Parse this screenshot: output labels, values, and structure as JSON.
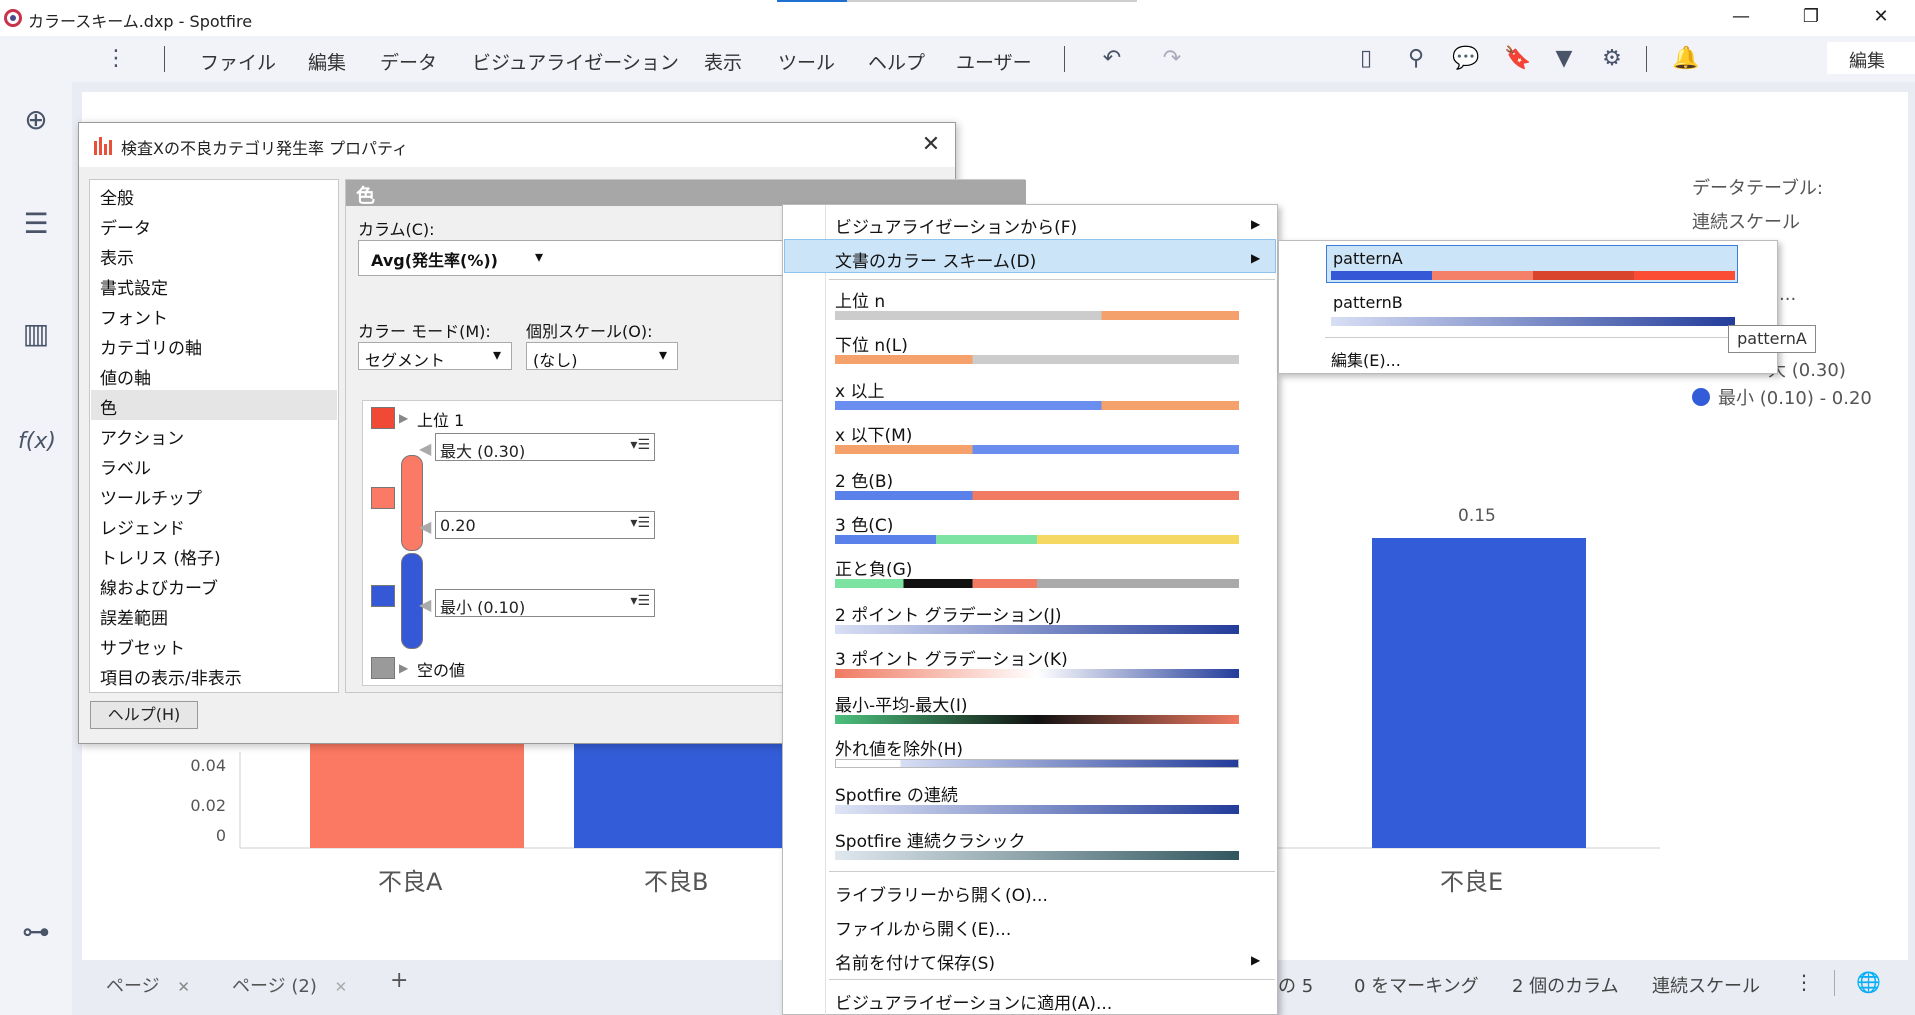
{
  "window": {
    "title": "カラースキーム.dxp - Spotfire",
    "minimize": "—",
    "maximize": "❐",
    "close": "✕"
  },
  "menubar": {
    "overflow": "⋮",
    "items": [
      "ファイル",
      "編集",
      "データ",
      "ビジュアライゼーション",
      "表示",
      "ツール",
      "ヘルプ",
      "ユーザー"
    ],
    "mode_select": "編集",
    "mode_chevron": "⌄"
  },
  "chart": {
    "categories": [
      "不良A",
      "不良B",
      "不良E"
    ],
    "bar_E_value_label": "0.15",
    "y_ticks": [
      "0.04",
      "0.02",
      "0"
    ],
    "legend": {
      "line1": "データテーブル:",
      "line2": "連続スケール",
      "partial1": "(...",
      "max_label": "大 (0.30)",
      "min_label": "最小 (0.10) - 0.20"
    },
    "colors": {
      "bar_A": "#fb7862",
      "bar_B": "#335dd8",
      "bar_red": "#fb4d34",
      "bar_E": "#335dd8"
    }
  },
  "bottom_bar": {
    "tabs": [
      {
        "label": "ページ",
        "close": "✕"
      },
      {
        "label": "ページ (2)",
        "close": "✕"
      }
    ],
    "add_tab": "+",
    "status": [
      "の 5",
      "0 をマーキング",
      "2 個のカラム",
      "連続スケール"
    ],
    "overflow": "⋮"
  },
  "dialog": {
    "title": "検査Xの不良カテゴリ発生率 プロパティ",
    "close": "✕",
    "nav_items": [
      "全般",
      "データ",
      "表示",
      "書式設定",
      "フォント",
      "カテゴリの軸",
      "値の軸",
      "色",
      "アクション",
      "ラベル",
      "ツールチップ",
      "レジェンド",
      "トレリス (格子)",
      "線およびカーブ",
      "誤差範囲",
      "サブセット",
      "項目の表示/非表示"
    ],
    "selected_nav_index": 7,
    "help_button": "ヘルプ(H)",
    "panel_title": "色",
    "column_label": "カラム(C):",
    "column_value": "Avg(発生率(%))",
    "color_mode_label": "カラー モード(M):",
    "color_mode_value": "セグメント",
    "individual_scale_label": "個別スケール(O):",
    "individual_scale_value": "(なし)",
    "top_rule": "上位 1",
    "max_value": "最大 (0.30)",
    "mid_value": "0.20",
    "min_value": "最小 (0.10)",
    "empty_value": "空の値",
    "dd_arrow": "▾",
    "menu_glyph": "▾☰",
    "colors": {
      "top": "#f04a36",
      "upper": "#fa7a66",
      "lower": "#3558d6",
      "empty": "#9a9a9a"
    }
  },
  "context_menu": {
    "items": {
      "from_vis": "ビジュアライゼーションから(F)",
      "doc_schemes": "文書のカラー スキーム(D)",
      "top_n": "上位 n",
      "bottom_n": "下位 n(L)",
      "x_above": "x 以上",
      "x_below": "x 以下(M)",
      "two_color": "2 色(B)",
      "three_color": "3 色(C)",
      "pos_neg": "正と負(G)",
      "two_point": "2 ポイント グラデーション(J)",
      "three_point": "3 ポイント グラデーション(K)",
      "min_avg_max": "最小-平均-最大(I)",
      "exclude_outliers": "外れ値を除外(H)",
      "spotfire_cont": "Spotfire の連続",
      "spotfire_classic": "Spotfire 連続クラシック",
      "open_library": "ライブラリーから開く(O)...",
      "open_file": "ファイルから開く(E)...",
      "save_as": "名前を付けて保存(S)",
      "apply_vis": "ビジュアライゼーションに適用(A)..."
    },
    "arrow": "▶"
  },
  "submenu": {
    "patternA": "patternA",
    "patternB": "patternB",
    "edit": "編集(E)..."
  },
  "tooltip": "patternA"
}
